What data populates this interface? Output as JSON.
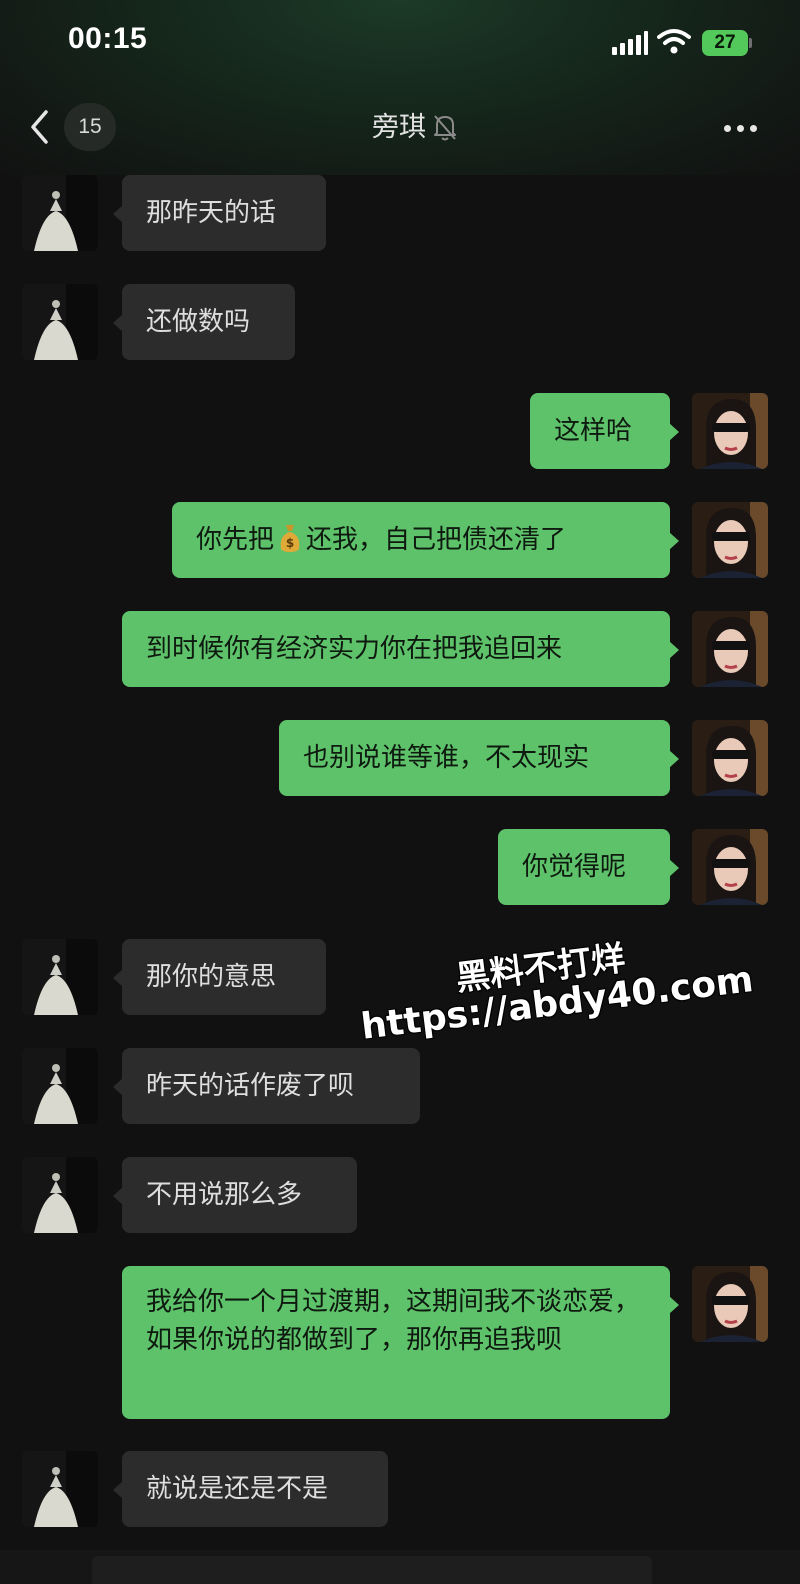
{
  "status_bar": {
    "time": "00:15",
    "battery": "27"
  },
  "header": {
    "back_badge": "15",
    "title": "旁琪",
    "muted": true
  },
  "messages": [
    {
      "side": "in",
      "text": "那昨天的话"
    },
    {
      "side": "in",
      "text": "还做数吗"
    },
    {
      "side": "out",
      "text": "这样哈"
    },
    {
      "side": "out",
      "text_before": "你先把",
      "emoji": "money-bag-icon",
      "text_after": "还我，自己把债还清了"
    },
    {
      "side": "out",
      "text": "到时候你有经济实力你在把我追回来"
    },
    {
      "side": "out",
      "text": "也别说谁等谁，不太现实"
    },
    {
      "side": "out",
      "text": "你觉得呢"
    },
    {
      "side": "in",
      "text": "那你的意思"
    },
    {
      "side": "in",
      "text": "昨天的话作废了呗"
    },
    {
      "side": "in",
      "text": "不用说那么多"
    },
    {
      "side": "out",
      "text": "我给你一个月过渡期，这期间我不谈恋爱，如果你说的都做到了，那你再追我呗"
    },
    {
      "side": "in",
      "text": "就说是还是不是"
    }
  ],
  "watermark": {
    "line1": "黑料不打烊",
    "line2": "https://abdy40.com"
  },
  "colors": {
    "background": "#111111",
    "incoming_bubble": "#2c2c2c",
    "outgoing_bubble": "#5ec26a",
    "battery": "#52c95a"
  }
}
